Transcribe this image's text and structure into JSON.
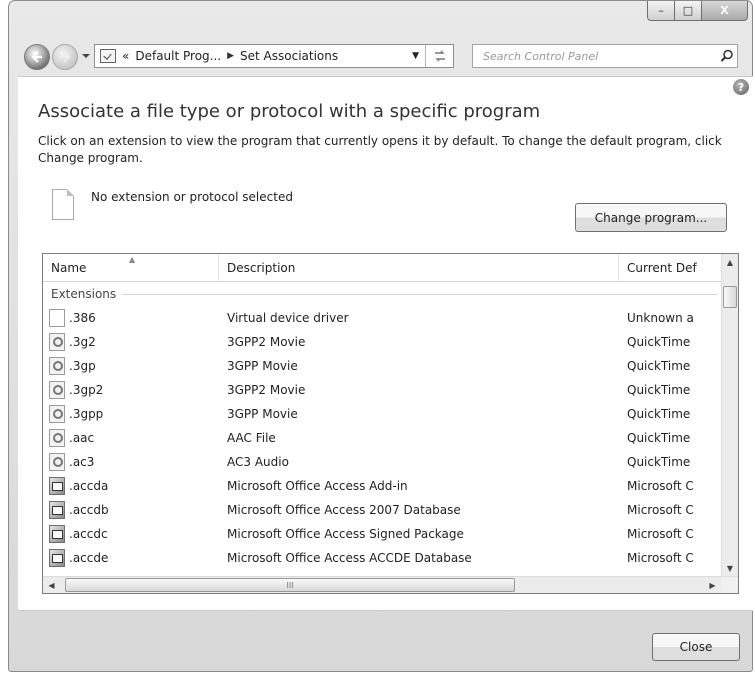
{
  "window": {
    "caption_buttons": {
      "minimize": "–",
      "maximize": "□",
      "close": "X"
    }
  },
  "navbar": {
    "breadcrumb_prefix": "«",
    "breadcrumbs": [
      "Default Prog...",
      "Set Associations"
    ],
    "search_placeholder": "Search Control Panel"
  },
  "header": {
    "help": "?",
    "title": "Associate a file type or protocol with a specific program",
    "description": "Click on an extension to view the program that currently opens it by default. To change the default program, click Change program."
  },
  "selection": {
    "label": "No extension or protocol selected",
    "change_button": "Change program..."
  },
  "list": {
    "columns": [
      "Name",
      "Description",
      "Current Def"
    ],
    "group_label": "Extensions",
    "rows": [
      {
        "name": ".386",
        "description": "Virtual device driver",
        "default": "Unknown a",
        "icon": "blank-file-icon"
      },
      {
        "name": ".3g2",
        "description": "3GPP2 Movie",
        "default": "QuickTime",
        "icon": "quicktime-file-icon"
      },
      {
        "name": ".3gp",
        "description": "3GPP Movie",
        "default": "QuickTime",
        "icon": "quicktime-file-icon"
      },
      {
        "name": ".3gp2",
        "description": "3GPP2 Movie",
        "default": "QuickTime",
        "icon": "quicktime-file-icon"
      },
      {
        "name": ".3gpp",
        "description": "3GPP Movie",
        "default": "QuickTime",
        "icon": "quicktime-file-icon"
      },
      {
        "name": ".aac",
        "description": "AAC File",
        "default": "QuickTime",
        "icon": "quicktime-file-icon"
      },
      {
        "name": ".ac3",
        "description": "AC3 Audio",
        "default": "QuickTime",
        "icon": "quicktime-file-icon"
      },
      {
        "name": ".accda",
        "description": "Microsoft Office Access Add-in",
        "default": "Microsoft C",
        "icon": "access-file-icon"
      },
      {
        "name": ".accdb",
        "description": "Microsoft Office Access 2007 Database",
        "default": "Microsoft C",
        "icon": "access-file-icon"
      },
      {
        "name": ".accdc",
        "description": "Microsoft Office Access Signed Package",
        "default": "Microsoft C",
        "icon": "access-file-icon"
      },
      {
        "name": ".accde",
        "description": "Microsoft Office Access ACCDE Database",
        "default": "Microsoft C",
        "icon": "access-file-icon"
      }
    ],
    "hscroll_grip": "III"
  },
  "footer": {
    "close_button": "Close"
  }
}
